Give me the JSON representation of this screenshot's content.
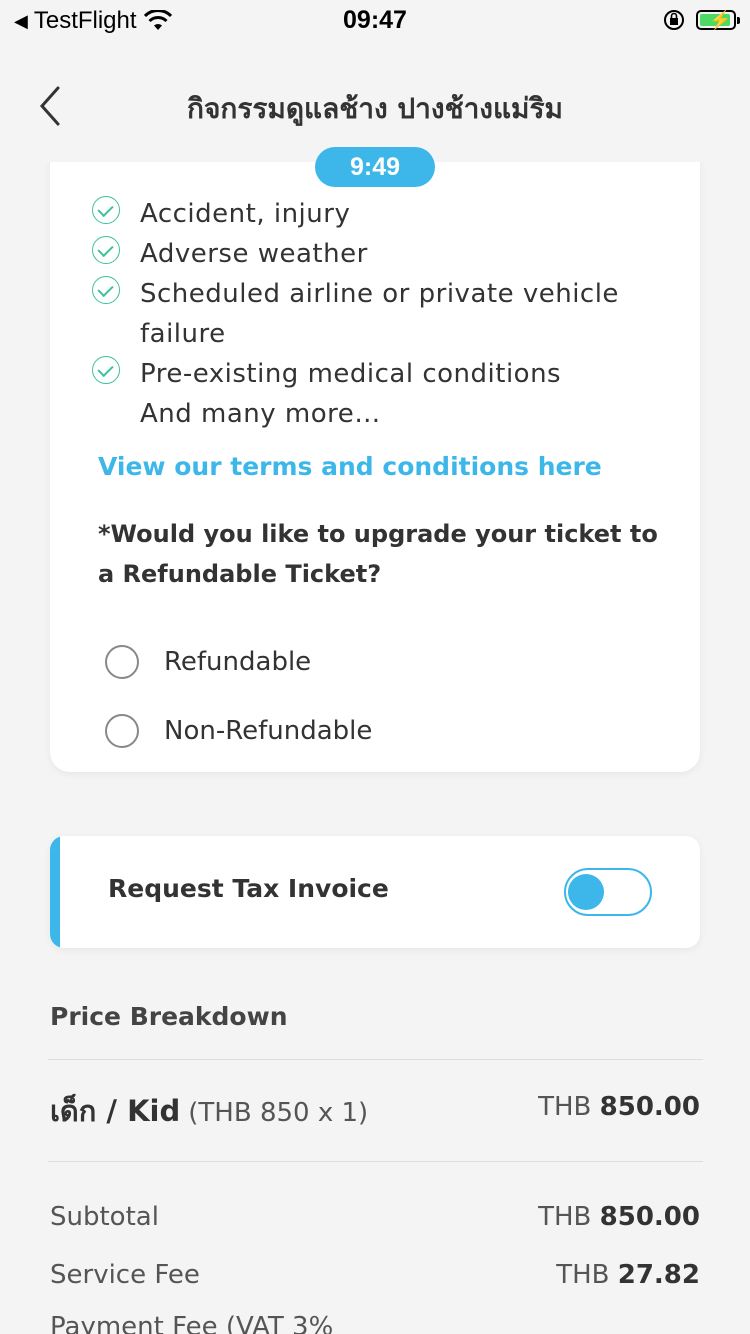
{
  "status_bar": {
    "carrier": "TestFlight",
    "time": "09:47"
  },
  "nav": {
    "title": "กิจกรรมดูแลช้าง ปางช้างแม่ริม",
    "timer": "9:49"
  },
  "coverage": {
    "items": [
      {
        "text": "Accident, injury"
      },
      {
        "text": "Adverse weather"
      },
      {
        "text": "Scheduled airline or private vehicle"
      },
      {
        "text": "failure"
      },
      {
        "text": "Pre-existing medical conditions"
      },
      {
        "text": "And many more…"
      }
    ],
    "terms_link": "View our terms and conditions here",
    "question": "*Would you like to upgrade your ticket to a Refundable Ticket?",
    "options": [
      "Refundable",
      "Non-Refundable"
    ]
  },
  "tax_invoice": {
    "label": "Request Tax Invoice",
    "enabled": false
  },
  "price_breakdown": {
    "title": "Price Breakdown",
    "items": [
      {
        "name": "เด็ก / Kid",
        "detail": "(THB 850 x 1)",
        "currency": "THB",
        "amount": "850.00"
      }
    ],
    "subtotal": {
      "label": "Subtotal",
      "currency": "THB",
      "amount": "850.00"
    },
    "service_fee": {
      "label": "Service Fee",
      "currency": "THB",
      "amount": "27.82"
    },
    "payment_fee": {
      "label": "Payment Fee (VAT 3%"
    }
  },
  "colors": {
    "accent": "#3db7ea",
    "check": "#3cc39b",
    "arc": "#1eb36b"
  }
}
